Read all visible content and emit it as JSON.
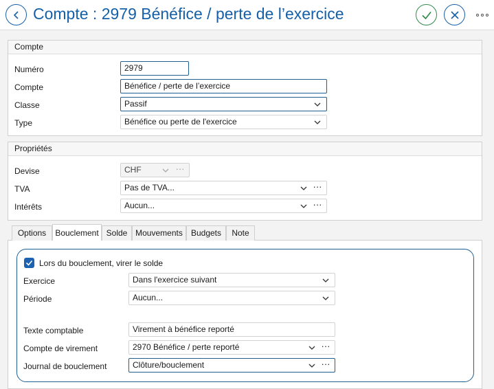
{
  "header": {
    "title": "Compte : 2979 Bénéfice / perte de l’exercice",
    "back_icon": "chevron-left-icon",
    "confirm_icon": "check-icon",
    "cancel_icon": "close-icon",
    "more_icon": "more-horizontal-icon",
    "accent": "#1560a8",
    "confirm_color": "#2f8a4a"
  },
  "compte_section": {
    "heading": "Compte",
    "numero": {
      "label": "Numéro",
      "value": "2979"
    },
    "compte": {
      "label": "Compte",
      "value": "Bénéfice / perte de l’exercice"
    },
    "classe": {
      "label": "Classe",
      "value": "Passif"
    },
    "type": {
      "label": "Type",
      "value": "Bénéfice ou perte de l'exercice"
    }
  },
  "proprietes_section": {
    "heading": "Propriétés",
    "devise": {
      "label": "Devise",
      "value": "CHF"
    },
    "tva": {
      "label": "TVA",
      "value": "Pas de TVA..."
    },
    "interets": {
      "label": "Intérêts",
      "value": "Aucun..."
    }
  },
  "tabs": [
    {
      "label": "Options"
    },
    {
      "label": "Bouclement"
    },
    {
      "label": "Solde"
    },
    {
      "label": "Mouvements"
    },
    {
      "label": "Budgets"
    },
    {
      "label": "Note"
    }
  ],
  "active_tab": "Bouclement",
  "bouclement": {
    "virer_solde": {
      "label": "Lors du bouclement, virer le solde",
      "checked": true
    },
    "exercice": {
      "label": "Exercice",
      "value": "Dans l'exercice suivant"
    },
    "periode": {
      "label": "Période",
      "value": "Aucun..."
    },
    "texte_comptable": {
      "label": "Texte comptable",
      "value": "Virement à bénéfice reporté"
    },
    "compte_virement": {
      "label": "Compte de virement",
      "value": "2970 Bénéfice / perte reporté"
    },
    "journal": {
      "label": "Journal de bouclement",
      "value": "Clôture/bouclement"
    }
  },
  "dots_text": "···"
}
